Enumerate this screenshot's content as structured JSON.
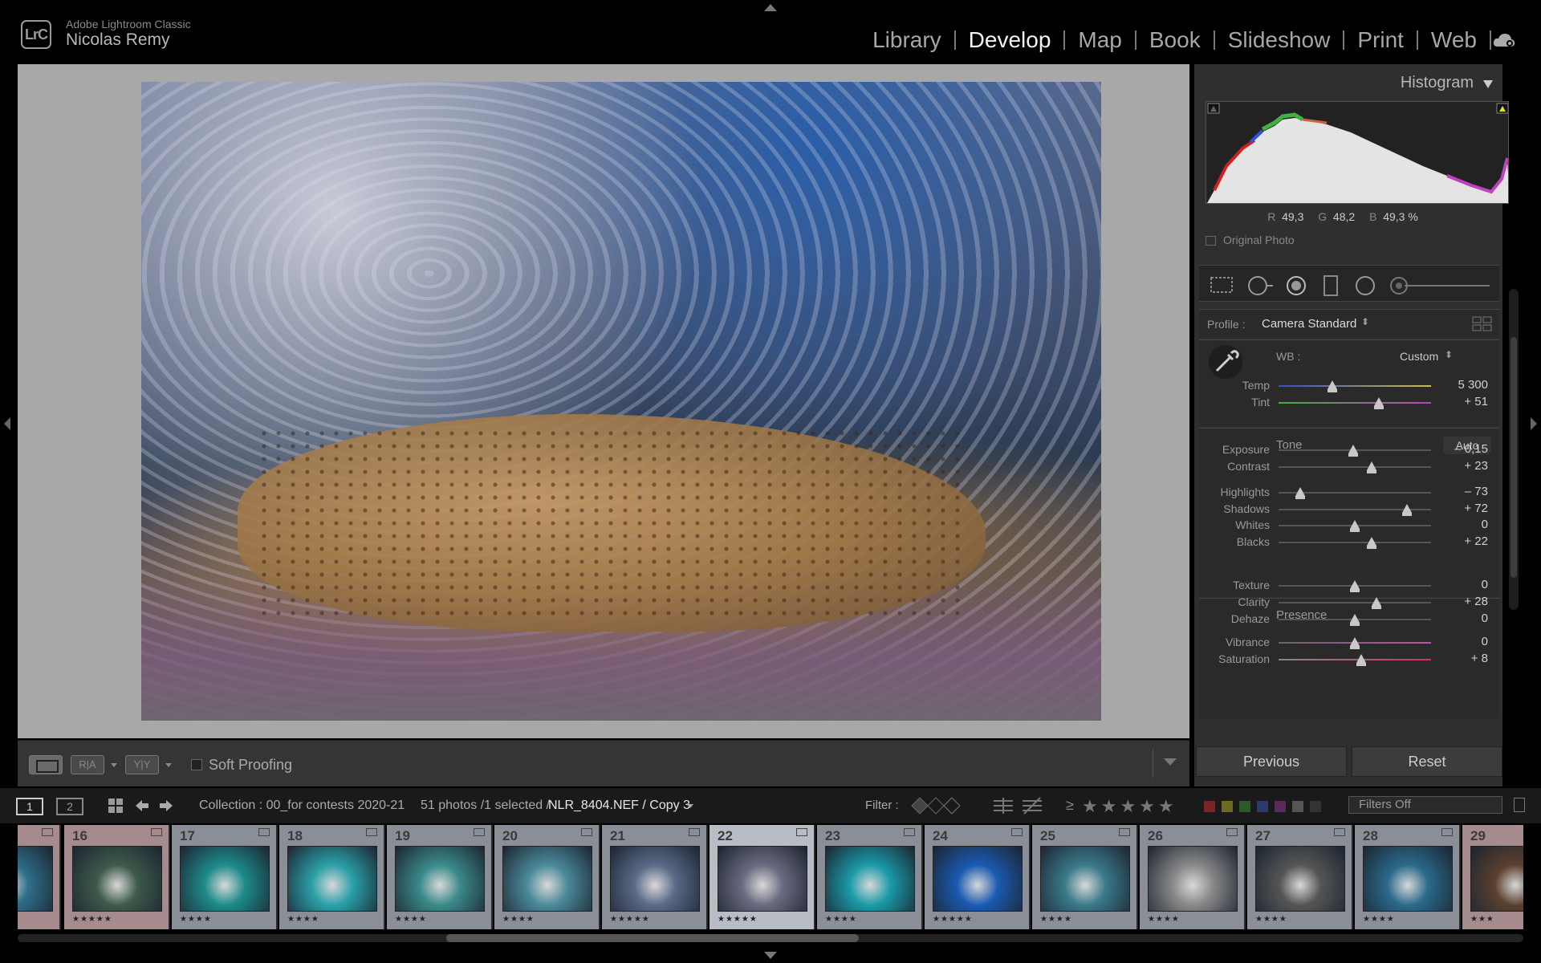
{
  "app": {
    "logo": "LrC",
    "name": "Adobe Lightroom Classic",
    "user": "Nicolas Remy"
  },
  "modules": [
    "Library",
    "Develop",
    "Map",
    "Book",
    "Slideshow",
    "Print",
    "Web"
  ],
  "active_module": "Develop",
  "toolbar": {
    "ra": "R|A",
    "yy": "Y|Y",
    "soft_proofing": "Soft Proofing"
  },
  "histogram": {
    "title": "Histogram",
    "r_label": "R",
    "r": "49,3",
    "g_label": "G",
    "g": "48,2",
    "b_label": "B",
    "b": "49,3 %",
    "original_photo": "Original Photo"
  },
  "basic": {
    "profile_label": "Profile :",
    "profile": "Camera Standard",
    "wb_label": "WB :",
    "wb": "Custom",
    "tone_label": "Tone",
    "auto": "Auto",
    "presence_label": "Presence",
    "sliders": [
      {
        "label": "Temp",
        "value": "5 300",
        "pos": 0.35
      },
      {
        "label": "Tint",
        "value": "+ 51",
        "pos": 0.66
      },
      {
        "label": "Exposure",
        "value": "– 0,15",
        "pos": 0.49
      },
      {
        "label": "Contrast",
        "value": "+ 23",
        "pos": 0.61
      },
      {
        "label": "Highlights",
        "value": "– 73",
        "pos": 0.14
      },
      {
        "label": "Shadows",
        "value": "+ 72",
        "pos": 0.84
      },
      {
        "label": "Whites",
        "value": "0",
        "pos": 0.5
      },
      {
        "label": "Blacks",
        "value": "+ 22",
        "pos": 0.61
      },
      {
        "label": "Texture",
        "value": "0",
        "pos": 0.5
      },
      {
        "label": "Clarity",
        "value": "+ 28",
        "pos": 0.64
      },
      {
        "label": "Dehaze",
        "value": "0",
        "pos": 0.5
      },
      {
        "label": "Vibrance",
        "value": "0",
        "pos": 0.5
      },
      {
        "label": "Saturation",
        "value": "+ 8",
        "pos": 0.54
      }
    ]
  },
  "buttons": {
    "previous": "Previous",
    "reset": "Reset"
  },
  "filmbar": {
    "monitor1": "1",
    "monitor2": "2",
    "collection": "Collection : 00_for contests 2020-21",
    "count": "51 photos /1 selected /",
    "file": "NLR_8404.NEF / Copy 3",
    "filter_label": "Filter :",
    "rating_op": "≥",
    "stars": "★★★★★",
    "filters_off": "Filters Off"
  },
  "filmstrip": [
    {
      "num": "",
      "stars": "★★★★★",
      "color": "#2f6f8a",
      "style": "pink"
    },
    {
      "num": "16",
      "stars": "★★★★★",
      "color": "#3d5a4a",
      "style": "pink"
    },
    {
      "num": "17",
      "stars": "★★★★",
      "color": "#1d8a8a",
      "style": ""
    },
    {
      "num": "18",
      "stars": "★★★★",
      "color": "#2aa0a8",
      "style": ""
    },
    {
      "num": "19",
      "stars": "★★★★",
      "color": "#3a8a8a",
      "style": ""
    },
    {
      "num": "20",
      "stars": "★★★★",
      "color": "#4a8a9a",
      "style": ""
    },
    {
      "num": "21",
      "stars": "★★★★★",
      "color": "#5a6a88",
      "style": ""
    },
    {
      "num": "22",
      "stars": "★★★★★",
      "color": "#6a6a80",
      "style": "selected"
    },
    {
      "num": "23",
      "stars": "★★★★",
      "color": "#1a9aa8",
      "style": ""
    },
    {
      "num": "24",
      "stars": "★★★★★",
      "color": "#1a5ab0",
      "style": ""
    },
    {
      "num": "25",
      "stars": "★★★★",
      "color": "#3a7a8a",
      "style": ""
    },
    {
      "num": "26",
      "stars": "★★★★",
      "color": "#888888",
      "style": ""
    },
    {
      "num": "27",
      "stars": "★★★★",
      "color": "#555555",
      "style": ""
    },
    {
      "num": "28",
      "stars": "★★★★",
      "color": "#2a6a8a",
      "style": ""
    },
    {
      "num": "29",
      "stars": "★★★",
      "color": "#5a4030",
      "style": "pink"
    }
  ],
  "colors": {
    "accent": "#f2f2f2",
    "panel": "#2f2f2f",
    "background": "#000000"
  }
}
